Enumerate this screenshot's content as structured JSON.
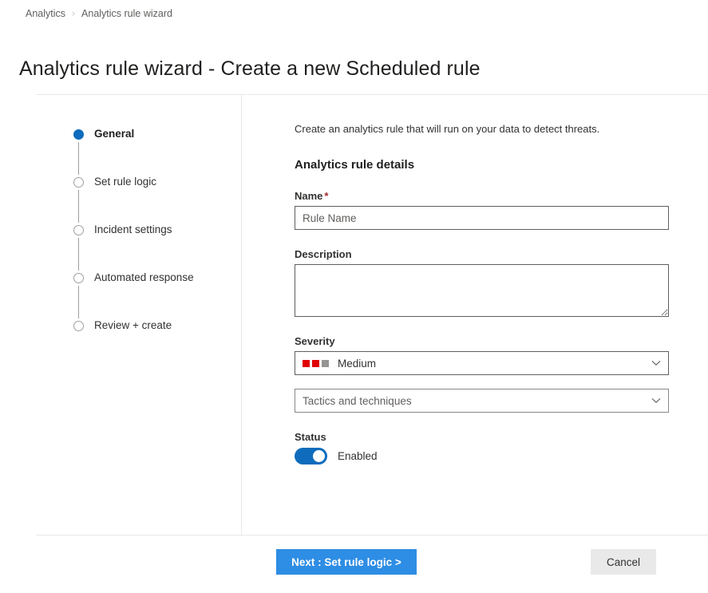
{
  "breadcrumb": {
    "items": [
      {
        "label": "Analytics"
      },
      {
        "label": "Analytics rule wizard"
      }
    ],
    "separator": "›"
  },
  "header": {
    "title": "Analytics rule wizard - Create a new Scheduled rule"
  },
  "wizard": {
    "steps": [
      {
        "label": "General",
        "state": "active"
      },
      {
        "label": "Set rule logic",
        "state": "pending"
      },
      {
        "label": "Incident settings",
        "state": "pending"
      },
      {
        "label": "Automated response",
        "state": "pending"
      },
      {
        "label": "Review + create",
        "state": "pending"
      }
    ]
  },
  "main": {
    "intro": "Create an analytics rule that will run on your data to detect threats.",
    "section_title": "Analytics rule details",
    "name": {
      "label": "Name",
      "required_marker": "*",
      "value": "",
      "placeholder": "Rule Name"
    },
    "description": {
      "label": "Description",
      "value": "",
      "placeholder": ""
    },
    "severity": {
      "label": "Severity",
      "value": "Medium",
      "indicator_colors": [
        "#e00000",
        "#e00000",
        "#979593"
      ]
    },
    "tactics": {
      "value": "Tactics and techniques"
    },
    "status": {
      "label": "Status",
      "toggle_value": "Enabled",
      "enabled": true
    }
  },
  "footer": {
    "next_label": "Next : Set rule logic >",
    "cancel_label": "Cancel"
  },
  "colors": {
    "accent": "#0f6cbd",
    "primary_button": "#2e8de4",
    "required": "#a4262c",
    "severity_red": "#e00000",
    "severity_gray": "#979593"
  }
}
